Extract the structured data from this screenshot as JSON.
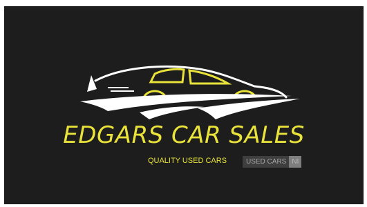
{
  "logo": {
    "title": "EDGARS CAR SALES",
    "tagline": "QUALITY USED CARS",
    "icon": "car-silhouette-icon"
  },
  "badge": {
    "main_label": "USED CARS",
    "side_label": "NI"
  },
  "colors": {
    "background": "#1d1d1d",
    "page": "#ffffff",
    "accent": "#e9e23a",
    "car_outline": "#ffffff",
    "badge_main_bg": "#3e3e3e",
    "badge_main_text": "#a8a8a8",
    "badge_side_bg": "#7e7e7e",
    "badge_side_text": "#b8b8b8"
  }
}
